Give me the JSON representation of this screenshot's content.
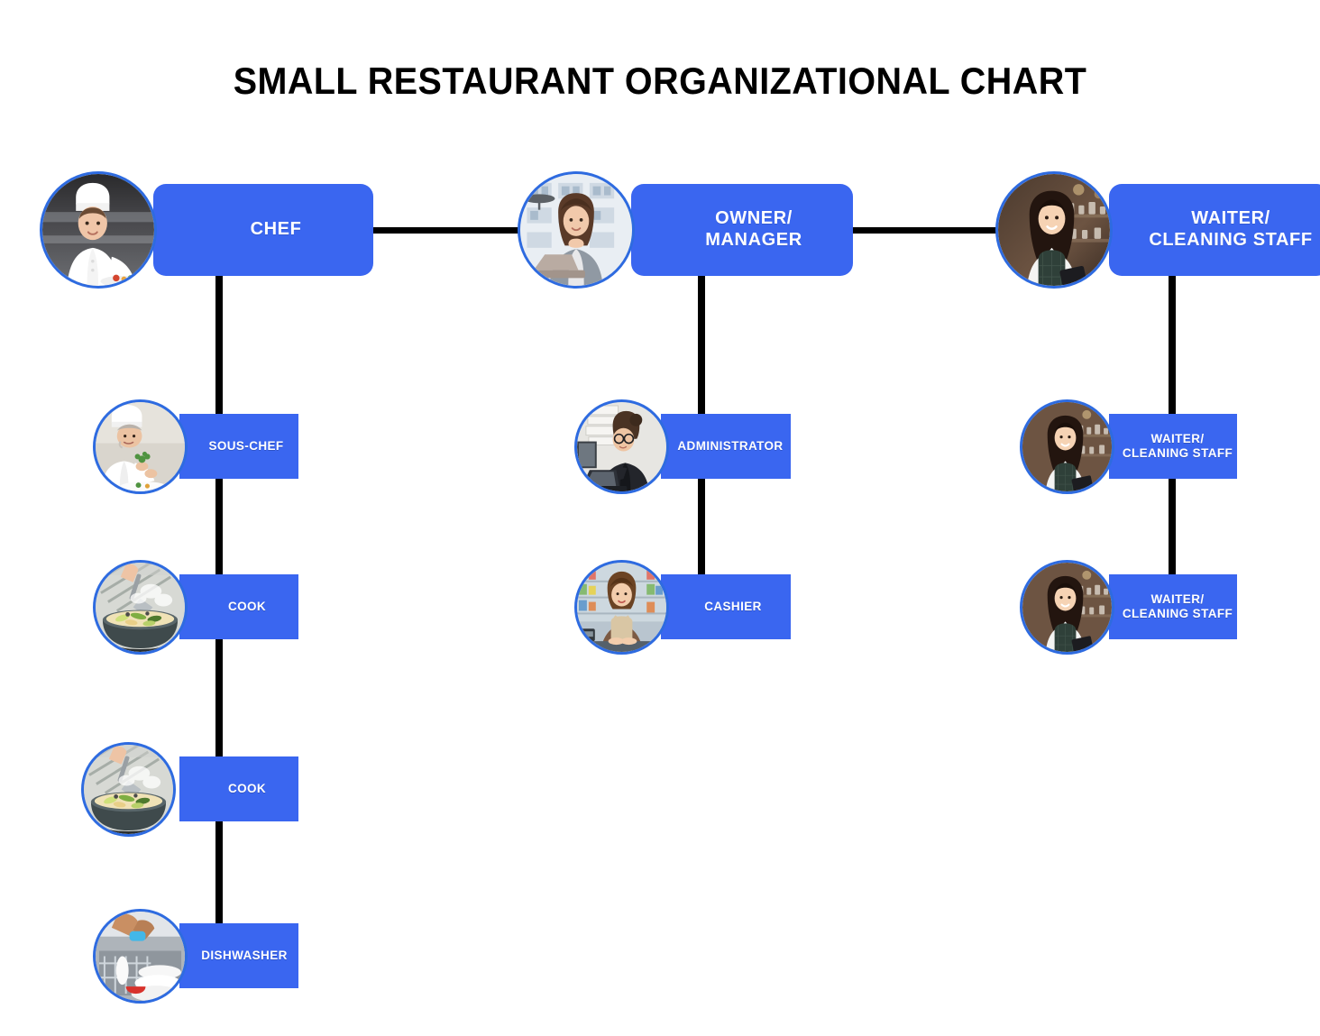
{
  "title": "SMALL RESTAURANT ORGANIZATIONAL CHART",
  "theme": {
    "node_fill": "#3A66F0",
    "node_text": "#FFFFFF",
    "connector": "#000000",
    "photo_ring": "#2E6BE0",
    "background": "#FFFFFF",
    "title_color": "#000000"
  },
  "chart_data": {
    "type": "diagram",
    "diagram_kind": "organizational-chart",
    "title": "SMALL RESTAURANT ORGANIZATIONAL CHART",
    "levels": 2,
    "root_row": [
      "Chef",
      "Owner/Manager",
      "Waiter/Cleaning Staff"
    ],
    "nodes": [
      {
        "id": "chef",
        "label": "CHEF",
        "level": 1,
        "photo": "chef-female-plating",
        "children": [
          "sous-chef",
          "cook-1",
          "cook-2",
          "dishwasher"
        ]
      },
      {
        "id": "owner",
        "label": "OWNER/\nMANAGER",
        "level": 1,
        "photo": "manager-female-desk",
        "children": [
          "administrator",
          "cashier"
        ]
      },
      {
        "id": "waiter",
        "label": "WAITER/\nCLEANING STAFF",
        "level": 1,
        "photo": "waitress-apron-tablet",
        "children": [
          "waiter-2",
          "waiter-3"
        ]
      },
      {
        "id": "sous-chef",
        "label": "SOUS-CHEF",
        "level": 2,
        "photo": "chef-male-garnishing",
        "parent": "chef"
      },
      {
        "id": "cook-1",
        "label": "COOK",
        "level": 2,
        "photo": "wok-stirfry",
        "parent": "chef"
      },
      {
        "id": "cook-2",
        "label": "COOK",
        "level": 2,
        "photo": "wok-stirfry",
        "parent": "chef"
      },
      {
        "id": "dishwasher",
        "label": "DISHWASHER",
        "level": 2,
        "photo": "dishwasher-loading-plates",
        "parent": "chef"
      },
      {
        "id": "administrator",
        "label": "ADMINISTRATOR",
        "level": 2,
        "photo": "admin-female-laptop",
        "parent": "owner"
      },
      {
        "id": "cashier",
        "label": "CASHIER",
        "level": 2,
        "photo": "cashier-female-counter",
        "parent": "owner"
      },
      {
        "id": "waiter-2",
        "label": "WAITER/\nCLEANING STAFF",
        "level": 2,
        "photo": "waitress-apron-tablet",
        "parent": "waiter"
      },
      {
        "id": "waiter-3",
        "label": "WAITER/\nCLEANING STAFF",
        "level": 2,
        "photo": "waitress-apron-tablet",
        "parent": "waiter"
      }
    ],
    "edges": [
      {
        "from": "chef",
        "to": "owner",
        "kind": "horizontal-peer"
      },
      {
        "from": "owner",
        "to": "waiter",
        "kind": "horizontal-peer"
      },
      {
        "from": "chef",
        "to": "sous-chef",
        "kind": "vertical"
      },
      {
        "from": "chef",
        "to": "cook-1",
        "kind": "vertical"
      },
      {
        "from": "chef",
        "to": "cook-2",
        "kind": "vertical"
      },
      {
        "from": "chef",
        "to": "dishwasher",
        "kind": "vertical"
      },
      {
        "from": "owner",
        "to": "administrator",
        "kind": "vertical"
      },
      {
        "from": "owner",
        "to": "cashier",
        "kind": "vertical"
      },
      {
        "from": "waiter",
        "to": "waiter-2",
        "kind": "vertical"
      },
      {
        "from": "waiter",
        "to": "waiter-3",
        "kind": "vertical"
      }
    ]
  },
  "nodes": {
    "chef": {
      "line1": "CHEF",
      "line2": ""
    },
    "owner": {
      "line1": "OWNER/",
      "line2": "MANAGER"
    },
    "waiter": {
      "line1": "WAITER/",
      "line2": "CLEANING STAFF"
    },
    "sous_chef": {
      "line1": "SOUS-CHEF",
      "line2": ""
    },
    "cook_1": {
      "line1": "COOK",
      "line2": ""
    },
    "cook_2": {
      "line1": "COOK",
      "line2": ""
    },
    "dishwasher": {
      "line1": "DISHWASHER",
      "line2": ""
    },
    "administrator": {
      "line1": "ADMINISTRATOR",
      "line2": ""
    },
    "cashier": {
      "line1": "CASHIER",
      "line2": ""
    },
    "waiter_2": {
      "line1": "WAITER/",
      "line2": "CLEANING STAFF"
    },
    "waiter_3": {
      "line1": "WAITER/",
      "line2": "CLEANING STAFF"
    }
  }
}
